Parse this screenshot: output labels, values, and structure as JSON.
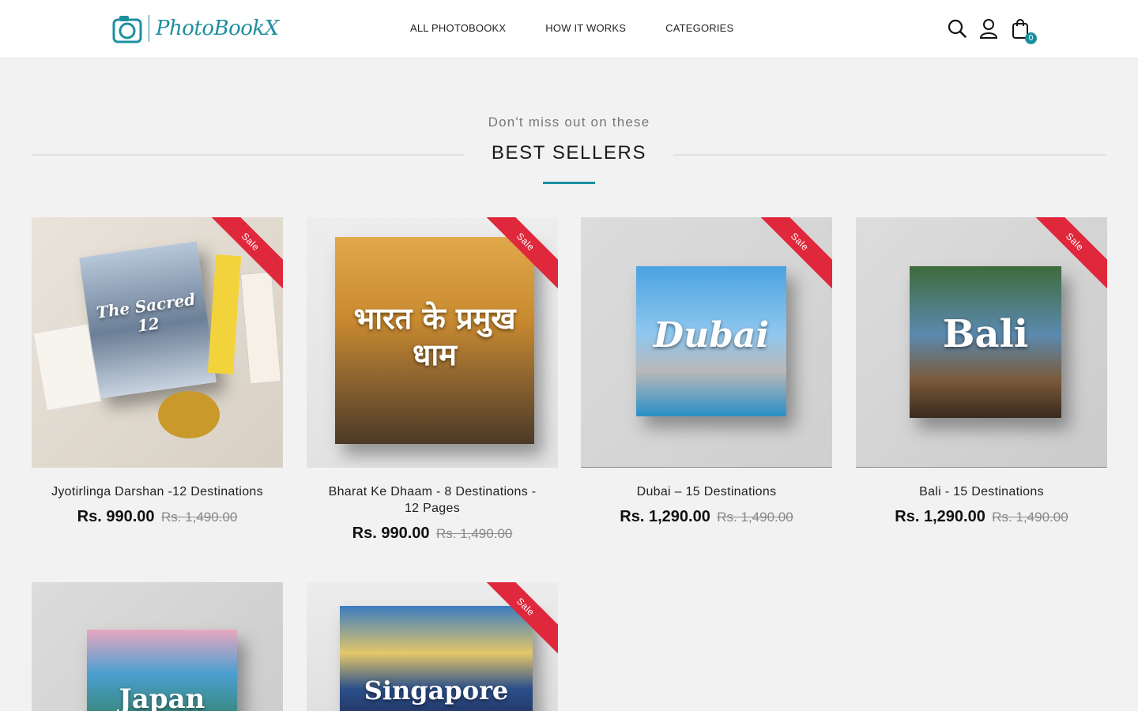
{
  "header": {
    "logo_text": "PhotoBookX",
    "nav": [
      "ALL PHOTOBOOKX",
      "HOW IT WORKS",
      "CATEGORIES"
    ],
    "cart_count": "0"
  },
  "section": {
    "subheading": "Don't miss out on these",
    "title": "BEST SELLERS"
  },
  "products": [
    {
      "name": "Jyotirlinga Darshan -12 Destinations",
      "price": "Rs. 990.00",
      "old_price": "Rs. 1,490.00",
      "badge": "Sale",
      "cover_text": "The Sacred 12"
    },
    {
      "name": "Bharat Ke Dhaam - 8 Destinations - 12 Pages",
      "price": "Rs. 990.00",
      "old_price": "Rs. 1,490.00",
      "badge": "Sale",
      "cover_text": "भारत के प्रमुख धाम"
    },
    {
      "name": "Dubai – 15 Destinations",
      "price": "Rs. 1,290.00",
      "old_price": "Rs. 1,490.00",
      "badge": "Sale",
      "cover_text": "Dubai"
    },
    {
      "name": "Bali - 15 Destinations",
      "price": "Rs. 1,290.00",
      "old_price": "Rs. 1,490.00",
      "badge": "Sale",
      "cover_text": "Bali"
    },
    {
      "name": "",
      "price": "",
      "old_price": "",
      "badge": "",
      "cover_text": "Japan"
    },
    {
      "name": "",
      "price": "",
      "old_price": "",
      "badge": "Sale",
      "cover_text": "Singapore"
    }
  ],
  "colors": {
    "accent": "#1a8fa0",
    "sale": "#e0283c"
  }
}
